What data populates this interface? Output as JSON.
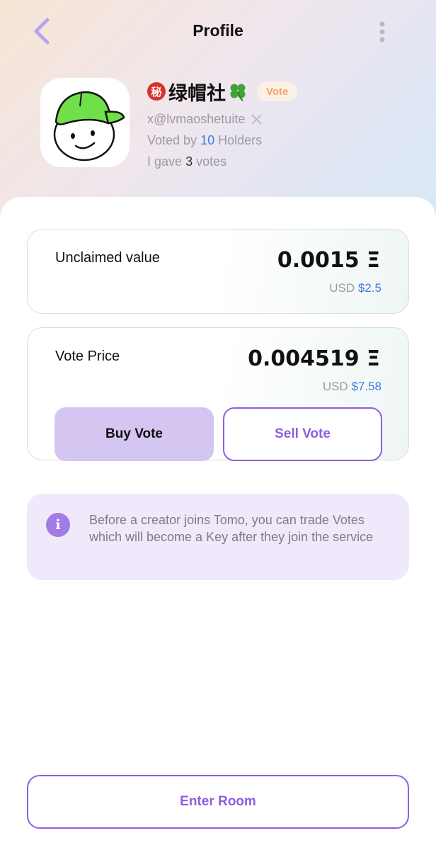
{
  "header": {
    "title": "Profile",
    "back_icon": "chevron-left-icon",
    "more_icon": "more-vertical-icon"
  },
  "profile": {
    "secret_glyph": "秘",
    "name": "绿帽社",
    "name_suffix_icon": "four-leaf-clover-icon",
    "badge": "Vote",
    "handle": "x@lvmaoshetuite",
    "handle_platform_icon": "x-logo-icon",
    "voted_prefix": "Voted by",
    "voted_count": "10",
    "voted_suffix": "Holders",
    "gave_prefix": "I gave",
    "gave_count": "3",
    "gave_suffix": "votes"
  },
  "unclaimed": {
    "label": "Unclaimed value",
    "value": "0.0015 Ξ",
    "usd_prefix": "USD",
    "usd_value": "$2.5"
  },
  "vote_price": {
    "label": "Vote Price",
    "value": "0.004519 Ξ",
    "usd_prefix": "USD",
    "usd_value": "$7.58",
    "buy_label": "Buy Vote",
    "sell_label": "Sell Vote"
  },
  "info": {
    "icon": "info-icon",
    "text": "Before a creator joins Tomo, you can trade Votes which will become a Key after they join the service"
  },
  "footer": {
    "enter_label": "Enter Room"
  },
  "colors": {
    "accent": "#8e5fe0",
    "buy_button_bg": "#d4c6f0",
    "usd_blue": "#3e7be0",
    "info_bg": "#efe9fb",
    "badge_text": "#f0a66a"
  }
}
